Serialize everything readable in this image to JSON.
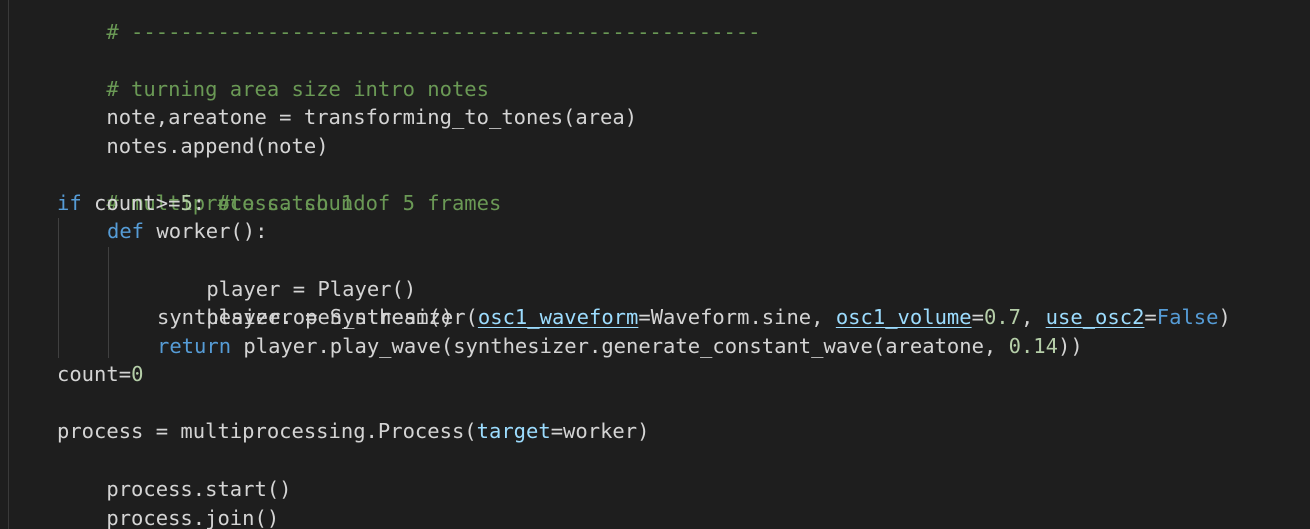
{
  "editor": {
    "language": "python",
    "theme_colors": {
      "background": "#1e1e1e",
      "text": "#d4d4d4",
      "comment": "#6a9955",
      "keyword": "#569cd6",
      "parameter": "#9cdcfe",
      "number": "#b5cea8"
    },
    "lines": {
      "l0": "# ---------------------------------------------------",
      "l2": "# turning area size intro notes",
      "l3": "note,areatone = transforming_to_tones(area)",
      "l4": "notes.append(note)",
      "l6": "# multiprocess. sound",
      "l7": {
        "kw": "if",
        "code": " count>=",
        "num": "5",
        "colon": ": ",
        "comment": "#to catch 1 of 5 frames"
      },
      "l8": {
        "kw": "def",
        "code": " worker():"
      },
      "l9": "player = Player()",
      "l10": "player.open_stream()",
      "l11": {
        "a": "synthesizer = Synthesizer(",
        "p1": "osc1_waveform",
        "b": "=Waveform.sine, ",
        "p2": "osc1_volume",
        "c": "=",
        "n1": "0.7",
        "d": ", ",
        "p3": "use_osc2",
        "e": "=",
        "k1": "False",
        "f": ")"
      },
      "l12": {
        "kw": "return",
        "a": " player.play_wave(synthesizer.generate_constant_wave(areatone, ",
        "n1": "0.14",
        "b": "))"
      },
      "l13": {
        "a": "count=",
        "n1": "0"
      },
      "l15": {
        "a": "process = multiprocessing.Process(",
        "p1": "target",
        "b": "=worker)"
      },
      "l16": "process.start()",
      "l17": "process.join()"
    }
  }
}
